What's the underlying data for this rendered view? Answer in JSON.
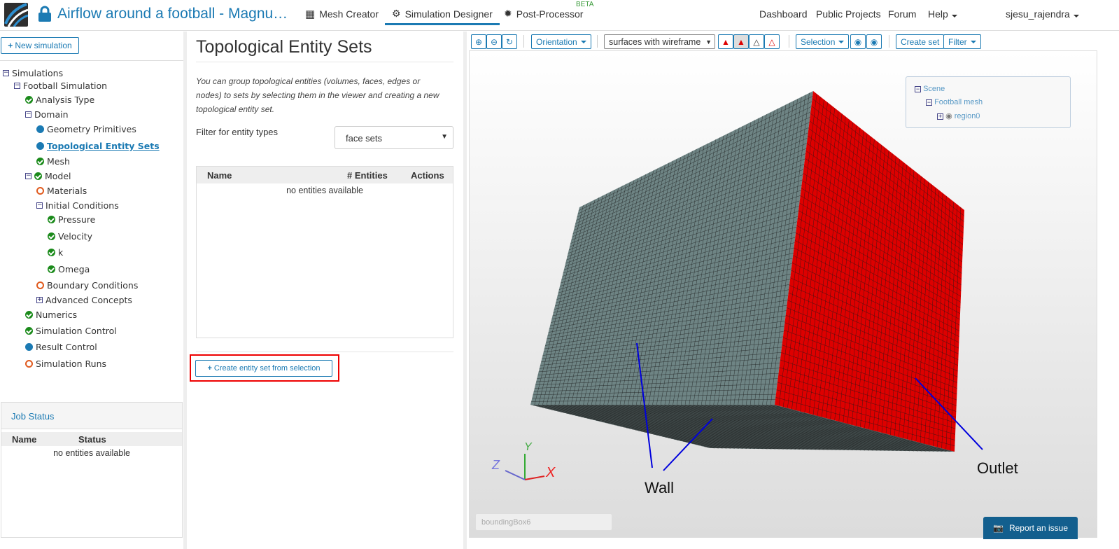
{
  "header": {
    "title": "Airflow around a football - Magnu…",
    "nav": [
      {
        "label": "Mesh Creator"
      },
      {
        "label": "Simulation Designer"
      },
      {
        "label": "Post-Processor"
      }
    ],
    "beta": "BETA",
    "right": [
      "Dashboard",
      "Public Projects",
      "Forum",
      "Help"
    ],
    "user": "sjesu_rajendra"
  },
  "sidebar": {
    "new_sim": "New simulation",
    "tree": [
      {
        "label": "Simulations",
        "state": "toggle"
      },
      {
        "label": "Football Simulation",
        "state": "toggle"
      },
      {
        "label": "Analysis Type",
        "state": "ok"
      },
      {
        "label": "Domain",
        "state": "toggle"
      },
      {
        "label": "Geometry Primitives",
        "state": "dot"
      },
      {
        "label": " Topological Entity Sets",
        "state": "dot"
      },
      {
        "label": "Mesh",
        "state": "ok"
      },
      {
        "label": "Model",
        "state": "toggle-ok"
      },
      {
        "label": "Materials",
        "state": "open"
      },
      {
        "label": "Initial Conditions",
        "state": "toggle"
      },
      {
        "label": "Pressure",
        "state": "ok"
      },
      {
        "label": "Velocity",
        "state": "ok"
      },
      {
        "label": "k",
        "state": "ok"
      },
      {
        "label": "Omega",
        "state": "ok"
      },
      {
        "label": "Boundary Conditions",
        "state": "open"
      },
      {
        "label": "Advanced Concepts",
        "state": "plus"
      },
      {
        "label": "Numerics",
        "state": "ok"
      },
      {
        "label": "Simulation Control",
        "state": "ok"
      },
      {
        "label": "Result Control",
        "state": "dot"
      },
      {
        "label": "Simulation Runs",
        "state": "open"
      }
    ],
    "job_status": {
      "title": "Job Status",
      "cols": [
        "Name",
        "Status"
      ],
      "empty": "no entities available"
    }
  },
  "main": {
    "title": "Topological Entity Sets",
    "description": "You can group topological entities (volumes, faces, edges or nodes) to sets by selecting them in the viewer and creating a new topological entity set.",
    "filter_label": "Filter for entity types",
    "filter_value": "face sets",
    "cols": [
      "Name",
      "# Entities",
      "Actions"
    ],
    "empty": "no entities available",
    "create_button": "Create entity set from selection"
  },
  "viewer": {
    "orientation": "Orientation",
    "render_mode": "surfaces with wireframe",
    "selection": "Selection",
    "create_set": "Create set",
    "filter": "Filter",
    "scene_tree": [
      "Scene",
      "Football mesh",
      "region0"
    ],
    "labels": {
      "wall": "Wall",
      "outlet": "Outlet"
    },
    "axes": {
      "x": "X",
      "y": "Y",
      "z": "Z"
    },
    "bbox": "boundingBox6",
    "report": "Report an issue",
    "colors": {
      "wall": "#6e8484",
      "outlet": "#dd0000",
      "accent": "#1b7ab3"
    }
  }
}
